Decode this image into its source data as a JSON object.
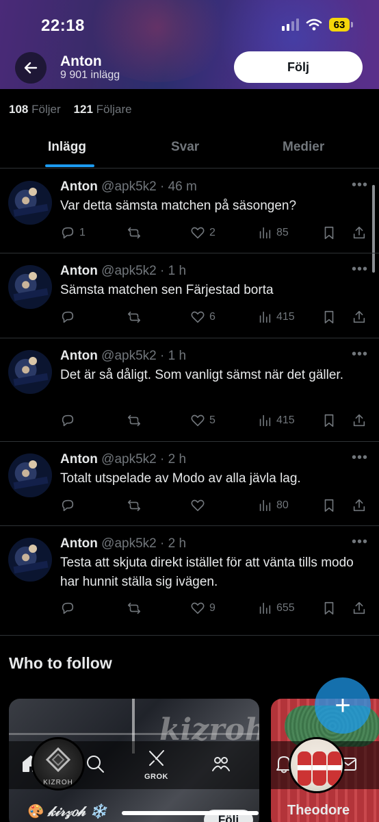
{
  "status_bar": {
    "time": "22:18",
    "battery": "63"
  },
  "header": {
    "name": "Anton",
    "post_count": "9 901 inlägg",
    "follow_label": "Följ"
  },
  "profile_stats": {
    "following_count": "108",
    "following_label": "Följer",
    "followers_count": "121",
    "followers_label": "Följare"
  },
  "tabs": [
    {
      "label": "Inlägg",
      "active": true
    },
    {
      "label": "Svar",
      "active": false
    },
    {
      "label": "Medier",
      "active": false
    }
  ],
  "tweets": [
    {
      "name": "Anton",
      "handle": "@apk5k2",
      "time": "46 m",
      "text": "Var detta sämsta matchen på säsongen?",
      "replies": "1",
      "retweets": "",
      "likes": "2",
      "views": "85"
    },
    {
      "name": "Anton",
      "handle": "@apk5k2",
      "time": "1 h",
      "text": "Sämsta matchen sen Färjestad borta",
      "replies": "",
      "retweets": "",
      "likes": "6",
      "views": "415"
    },
    {
      "name": "Anton",
      "handle": "@apk5k2",
      "time": "1 h",
      "text": "Det är så dåligt. Som vanligt sämst när det gäller.",
      "replies": "",
      "retweets": "",
      "likes": "5",
      "views": "415"
    },
    {
      "name": "Anton",
      "handle": "@apk5k2",
      "time": "2 h",
      "text": "Totalt utspelade av Modo av alla jävla lag.",
      "replies": "",
      "retweets": "",
      "likes": "",
      "views": "80"
    },
    {
      "name": "Anton",
      "handle": "@apk5k2",
      "time": "2 h",
      "text": "Testa att skjuta direkt istället för att vänta tills modo har hunnit ställa sig ivägen.",
      "replies": "",
      "retweets": "",
      "likes": "9",
      "views": "655"
    }
  ],
  "who_to_follow": {
    "title": "Who to follow",
    "cards": [
      {
        "name": "🎨 𝓀𝒾𝓇𝓏𝑜𝒽 ❄️",
        "avatar_text": "KIZROH",
        "follow_label": "Följ"
      },
      {
        "name": "Theodore"
      }
    ]
  },
  "bottom_nav": {
    "grok_label": "GROK"
  },
  "icons": [
    "back-arrow-icon",
    "reply-icon",
    "retweet-icon",
    "like-icon",
    "views-icon",
    "bookmark-icon",
    "share-icon",
    "more-icon",
    "compose-plus-icon",
    "home-icon",
    "search-icon",
    "grok-icon",
    "communities-icon",
    "notifications-icon",
    "messages-icon"
  ],
  "colors": {
    "accent": "#1d9bf0",
    "text": "#e7e9ea",
    "muted": "#71767b",
    "divider": "#2f3336",
    "battery": "#f5d60a"
  }
}
